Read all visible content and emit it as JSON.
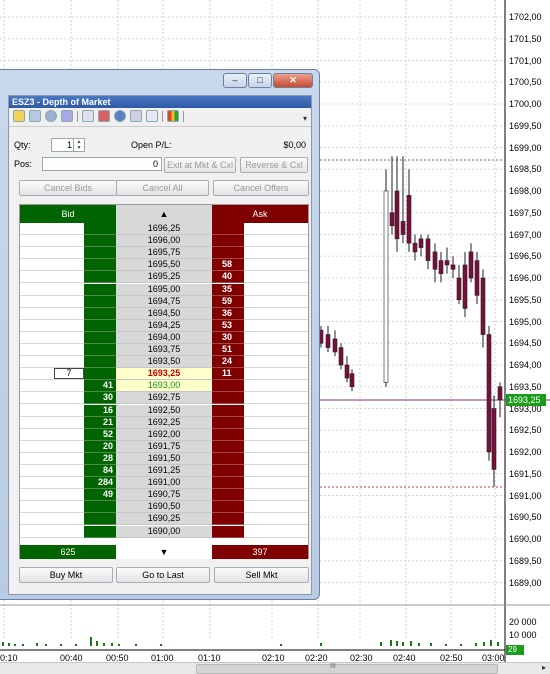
{
  "chart": {
    "price_labels": [
      "1702,00",
      "1701,50",
      "1701,00",
      "1700,50",
      "1700,00",
      "1699,50",
      "1699,00",
      "1698,50",
      "1698,00",
      "1697,50",
      "1697,00",
      "1696,50",
      "1696,00",
      "1695,50",
      "1695,00",
      "1694,50",
      "1694,00",
      "1693,50",
      "1693,00",
      "1692,50",
      "1692,00",
      "1691,50",
      "1691,00",
      "1690,50",
      "1690,00",
      "1689,50",
      "1689,00"
    ],
    "last_price_tag": "1693,25",
    "volume_labels": [
      "20 000",
      "10 000"
    ],
    "volume_tag": "29",
    "time_labels": [
      "0:10",
      "00:40",
      "00:50",
      "01:00",
      "01:10",
      "02:10",
      "02:20",
      "02:30",
      "02:40",
      "02:50",
      "03:00"
    ],
    "up_color": "#ffffff",
    "down_color": "#7a0f3c",
    "reference_lines": {
      "upper_green": "1698,75",
      "purple": "1693,25",
      "lower_red": "1691,00"
    },
    "scroll_grip": "III"
  },
  "left_panel_marks": [
    "0",
    "7",
    "0",
    "7",
    "5",
    "0",
    "5",
    "6",
    "5"
  ],
  "dom": {
    "title": "ESZ3 - Depth of Market",
    "qty_label": "Qty:",
    "qty_value": "1",
    "open_pl_label": "Open P/L:",
    "open_pl_value": "$0,00",
    "pos_label": "Pos:",
    "pos_value": "0",
    "exit_button": "Exit at Mkt & Cxl",
    "reverse_button": "Reverse & Cxl",
    "cancel_bids": "Cancel Bids",
    "cancel_all": "Cancel All",
    "cancel_offers": "Cancel Offers",
    "bid_header": "Bid",
    "ask_header": "Ask",
    "scroll_up": "▲",
    "scroll_down": "▼",
    "ladder": [
      {
        "price": "1696,25",
        "bid": "",
        "ask": ""
      },
      {
        "price": "1696,00",
        "bid": "",
        "ask": ""
      },
      {
        "price": "1695,75",
        "bid": "",
        "ask": ""
      },
      {
        "price": "1695,50",
        "bid": "",
        "ask": "58"
      },
      {
        "price": "1695,25",
        "bid": "",
        "ask": "40"
      },
      {
        "price": "1695,00",
        "bid": "",
        "ask": "35"
      },
      {
        "price": "1694,75",
        "bid": "",
        "ask": "59"
      },
      {
        "price": "1694,50",
        "bid": "",
        "ask": "36"
      },
      {
        "price": "1694,25",
        "bid": "",
        "ask": "53"
      },
      {
        "price": "1694,00",
        "bid": "",
        "ask": "30"
      },
      {
        "price": "1693,75",
        "bid": "",
        "ask": "51"
      },
      {
        "price": "1693,50",
        "bid": "",
        "ask": "24"
      },
      {
        "price": "1693,25",
        "bid": "",
        "ask": "11",
        "last_qty": "7",
        "highlight": "last"
      },
      {
        "price": "1693,00",
        "bid": "41",
        "ask": "",
        "highlight": "green"
      },
      {
        "price": "1692,75",
        "bid": "30",
        "ask": ""
      },
      {
        "price": "1692,50",
        "bid": "16",
        "ask": ""
      },
      {
        "price": "1692,25",
        "bid": "21",
        "ask": ""
      },
      {
        "price": "1692,00",
        "bid": "52",
        "ask": ""
      },
      {
        "price": "1691,75",
        "bid": "20",
        "ask": ""
      },
      {
        "price": "1691,50",
        "bid": "28",
        "ask": ""
      },
      {
        "price": "1691,25",
        "bid": "84",
        "ask": ""
      },
      {
        "price": "1691,00",
        "bid": "284",
        "ask": ""
      },
      {
        "price": "1690,75",
        "bid": "49",
        "ask": ""
      },
      {
        "price": "1690,50",
        "bid": "",
        "ask": ""
      },
      {
        "price": "1690,25",
        "bid": "",
        "ask": ""
      },
      {
        "price": "1690,00",
        "bid": "",
        "ask": ""
      }
    ],
    "bid_total": "625",
    "ask_total": "397",
    "buy_mkt": "Buy Mkt",
    "go_to_last": "Go to Last",
    "sell_mkt": "Sell Mkt",
    "colors": {
      "bid": "#006400",
      "ask": "#800000",
      "last_price": "#cc0000",
      "price_green": "#1a9b1a"
    }
  }
}
